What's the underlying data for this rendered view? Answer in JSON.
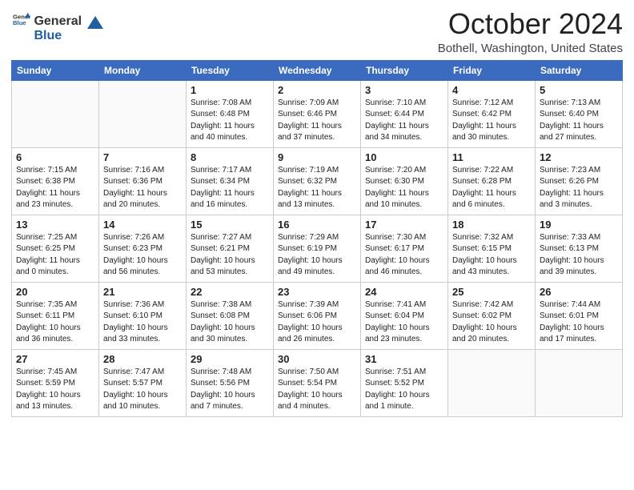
{
  "header": {
    "logo_general": "General",
    "logo_blue": "Blue",
    "month_title": "October 2024",
    "location": "Bothell, Washington, United States"
  },
  "days_of_week": [
    "Sunday",
    "Monday",
    "Tuesday",
    "Wednesday",
    "Thursday",
    "Friday",
    "Saturday"
  ],
  "weeks": [
    [
      {
        "day": "",
        "info": ""
      },
      {
        "day": "",
        "info": ""
      },
      {
        "day": "1",
        "info": "Sunrise: 7:08 AM\nSunset: 6:48 PM\nDaylight: 11 hours and 40 minutes."
      },
      {
        "day": "2",
        "info": "Sunrise: 7:09 AM\nSunset: 6:46 PM\nDaylight: 11 hours and 37 minutes."
      },
      {
        "day": "3",
        "info": "Sunrise: 7:10 AM\nSunset: 6:44 PM\nDaylight: 11 hours and 34 minutes."
      },
      {
        "day": "4",
        "info": "Sunrise: 7:12 AM\nSunset: 6:42 PM\nDaylight: 11 hours and 30 minutes."
      },
      {
        "day": "5",
        "info": "Sunrise: 7:13 AM\nSunset: 6:40 PM\nDaylight: 11 hours and 27 minutes."
      }
    ],
    [
      {
        "day": "6",
        "info": "Sunrise: 7:15 AM\nSunset: 6:38 PM\nDaylight: 11 hours and 23 minutes."
      },
      {
        "day": "7",
        "info": "Sunrise: 7:16 AM\nSunset: 6:36 PM\nDaylight: 11 hours and 20 minutes."
      },
      {
        "day": "8",
        "info": "Sunrise: 7:17 AM\nSunset: 6:34 PM\nDaylight: 11 hours and 16 minutes."
      },
      {
        "day": "9",
        "info": "Sunrise: 7:19 AM\nSunset: 6:32 PM\nDaylight: 11 hours and 13 minutes."
      },
      {
        "day": "10",
        "info": "Sunrise: 7:20 AM\nSunset: 6:30 PM\nDaylight: 11 hours and 10 minutes."
      },
      {
        "day": "11",
        "info": "Sunrise: 7:22 AM\nSunset: 6:28 PM\nDaylight: 11 hours and 6 minutes."
      },
      {
        "day": "12",
        "info": "Sunrise: 7:23 AM\nSunset: 6:26 PM\nDaylight: 11 hours and 3 minutes."
      }
    ],
    [
      {
        "day": "13",
        "info": "Sunrise: 7:25 AM\nSunset: 6:25 PM\nDaylight: 11 hours and 0 minutes."
      },
      {
        "day": "14",
        "info": "Sunrise: 7:26 AM\nSunset: 6:23 PM\nDaylight: 10 hours and 56 minutes."
      },
      {
        "day": "15",
        "info": "Sunrise: 7:27 AM\nSunset: 6:21 PM\nDaylight: 10 hours and 53 minutes."
      },
      {
        "day": "16",
        "info": "Sunrise: 7:29 AM\nSunset: 6:19 PM\nDaylight: 10 hours and 49 minutes."
      },
      {
        "day": "17",
        "info": "Sunrise: 7:30 AM\nSunset: 6:17 PM\nDaylight: 10 hours and 46 minutes."
      },
      {
        "day": "18",
        "info": "Sunrise: 7:32 AM\nSunset: 6:15 PM\nDaylight: 10 hours and 43 minutes."
      },
      {
        "day": "19",
        "info": "Sunrise: 7:33 AM\nSunset: 6:13 PM\nDaylight: 10 hours and 39 minutes."
      }
    ],
    [
      {
        "day": "20",
        "info": "Sunrise: 7:35 AM\nSunset: 6:11 PM\nDaylight: 10 hours and 36 minutes."
      },
      {
        "day": "21",
        "info": "Sunrise: 7:36 AM\nSunset: 6:10 PM\nDaylight: 10 hours and 33 minutes."
      },
      {
        "day": "22",
        "info": "Sunrise: 7:38 AM\nSunset: 6:08 PM\nDaylight: 10 hours and 30 minutes."
      },
      {
        "day": "23",
        "info": "Sunrise: 7:39 AM\nSunset: 6:06 PM\nDaylight: 10 hours and 26 minutes."
      },
      {
        "day": "24",
        "info": "Sunrise: 7:41 AM\nSunset: 6:04 PM\nDaylight: 10 hours and 23 minutes."
      },
      {
        "day": "25",
        "info": "Sunrise: 7:42 AM\nSunset: 6:02 PM\nDaylight: 10 hours and 20 minutes."
      },
      {
        "day": "26",
        "info": "Sunrise: 7:44 AM\nSunset: 6:01 PM\nDaylight: 10 hours and 17 minutes."
      }
    ],
    [
      {
        "day": "27",
        "info": "Sunrise: 7:45 AM\nSunset: 5:59 PM\nDaylight: 10 hours and 13 minutes."
      },
      {
        "day": "28",
        "info": "Sunrise: 7:47 AM\nSunset: 5:57 PM\nDaylight: 10 hours and 10 minutes."
      },
      {
        "day": "29",
        "info": "Sunrise: 7:48 AM\nSunset: 5:56 PM\nDaylight: 10 hours and 7 minutes."
      },
      {
        "day": "30",
        "info": "Sunrise: 7:50 AM\nSunset: 5:54 PM\nDaylight: 10 hours and 4 minutes."
      },
      {
        "day": "31",
        "info": "Sunrise: 7:51 AM\nSunset: 5:52 PM\nDaylight: 10 hours and 1 minute."
      },
      {
        "day": "",
        "info": ""
      },
      {
        "day": "",
        "info": ""
      }
    ]
  ]
}
